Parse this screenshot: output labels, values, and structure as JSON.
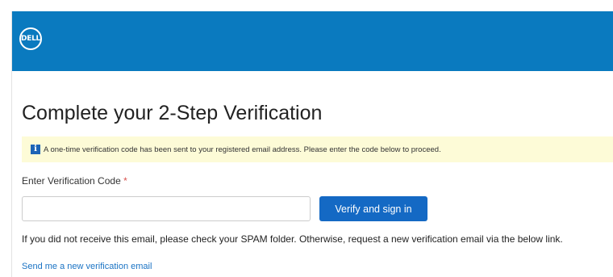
{
  "brand": {
    "logo_text": "DELL",
    "header_color": "#0a7abf"
  },
  "page": {
    "title": "Complete your 2-Step Verification"
  },
  "info_banner": {
    "icon": "info-icon",
    "icon_glyph": "i",
    "message": "A one-time verification code has been sent to your registered email address. Please enter the code below to proceed."
  },
  "form": {
    "code_label": "Enter Verification Code",
    "required_marker": "*",
    "code_value": "",
    "code_placeholder": "",
    "submit_label": "Verify and sign in",
    "submit_color": "#1469c4"
  },
  "help": {
    "text": "If you did not receive this email, please check your SPAM folder. Otherwise, request a new verification email via the below link.",
    "resend_link": "Send me a new verification email"
  }
}
